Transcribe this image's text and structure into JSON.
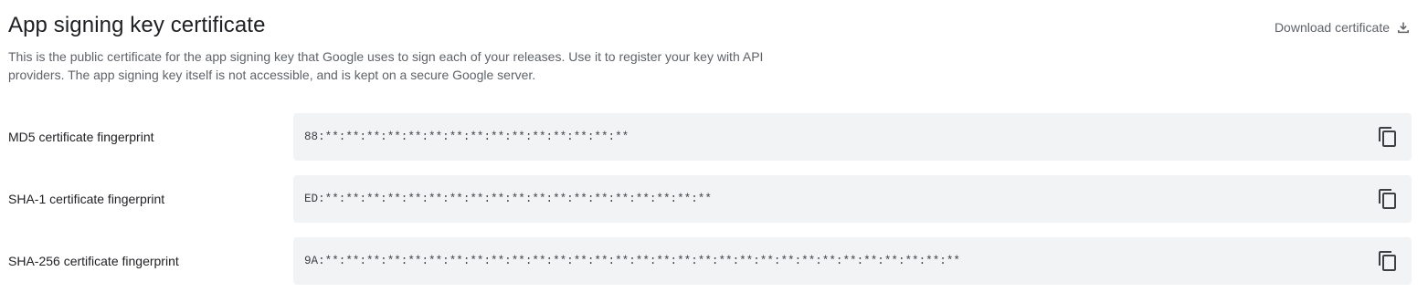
{
  "header": {
    "title": "App signing key certificate",
    "description": "This is the public certificate for the app signing key that Google uses to sign each of your releases. Use it to register your key with API providers. The app signing key itself is not accessible, and is kept on a secure Google server.",
    "download_label": "Download certificate",
    "download_icon": "download-icon"
  },
  "fingerprints": [
    {
      "label": "MD5 certificate fingerprint",
      "value": "88:**:**:**:**:**:**:**:**:**:**:**:**:**:**:**",
      "copy_icon": "copy-icon"
    },
    {
      "label": "SHA-1 certificate fingerprint",
      "value": "ED:**:**:**:**:**:**:**:**:**:**:**:**:**:**:**:**:**:**:**",
      "copy_icon": "copy-icon"
    },
    {
      "label": "SHA-256 certificate fingerprint",
      "value": "9A:**:**:**:**:**:**:**:**:**:**:**:**:**:**:**:**:**:**:**:**:**:**:**:**:**:**:**:**:**:**:**",
      "copy_icon": "copy-icon"
    }
  ],
  "colors": {
    "text_primary": "#202124",
    "text_secondary": "#5f6368",
    "field_background": "#f1f3f4"
  }
}
